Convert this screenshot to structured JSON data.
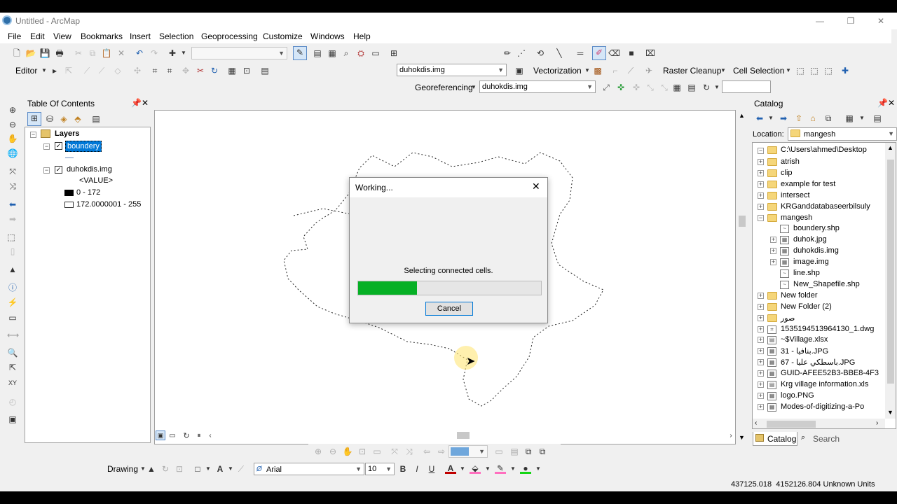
{
  "window": {
    "title": "Untitled - ArcMap",
    "minimize": "—",
    "restore": "❐",
    "close": "✕"
  },
  "menu": [
    "File",
    "Edit",
    "View",
    "Bookmarks",
    "Insert",
    "Selection",
    "Geoprocessing",
    "Customize",
    "Windows",
    "Help"
  ],
  "toolbar": {
    "editor_label": "Editor",
    "layer_combo": "duhokdis.img",
    "vectorization_label": "Vectorization",
    "raster_cleanup_label": "Raster Cleanup",
    "cell_selection_label": "Cell Selection",
    "georeferencing_label": "Georeferencing",
    "georef_layer_combo": "duhokdis.img"
  },
  "toc": {
    "title": "Table Of Contents",
    "layers_label": "Layers",
    "layer1_name": "boundery",
    "layer2_name": "duhokdis.img",
    "value_label": "<VALUE>",
    "legend1": "0 - 172",
    "legend2": "172.0000001 - 255"
  },
  "catalog": {
    "title": "Catalog",
    "location_label": "Location:",
    "location_value": "mangesh",
    "root": "C:\\Users\\ahmed\\Desktop",
    "items": [
      {
        "label": "atrish",
        "type": "folder",
        "level": 1
      },
      {
        "label": "clip",
        "type": "folder",
        "level": 1
      },
      {
        "label": "example for test",
        "type": "folder",
        "level": 1
      },
      {
        "label": "intersect",
        "type": "folder",
        "level": 1
      },
      {
        "label": "KRGanddatabaseerbilsuly",
        "type": "folder",
        "level": 1
      },
      {
        "label": "mangesh",
        "type": "folder-open",
        "level": 1
      },
      {
        "label": "boundery.shp",
        "type": "shp",
        "level": 2
      },
      {
        "label": "duhok.jpg",
        "type": "raster",
        "level": 2
      },
      {
        "label": "duhokdis.img",
        "type": "raster",
        "level": 2
      },
      {
        "label": "image.img",
        "type": "raster",
        "level": 2
      },
      {
        "label": "line.shp",
        "type": "shp",
        "level": 2
      },
      {
        "label": "New_Shapefile.shp",
        "type": "shp",
        "level": 2
      },
      {
        "label": "New folder",
        "type": "folder",
        "level": 1
      },
      {
        "label": "New Folder (2)",
        "type": "folder",
        "level": 1
      },
      {
        "label": "صور",
        "type": "folder",
        "level": 1
      },
      {
        "label": "1535194513964130_1.dwg",
        "type": "cad",
        "level": 1
      },
      {
        "label": "~$Village.xlsx",
        "type": "table",
        "level": 1
      },
      {
        "label": "31 - بنافيا.JPG",
        "type": "raster",
        "level": 1
      },
      {
        "label": "67 - باسطكي عليا.JPG",
        "type": "raster",
        "level": 1
      },
      {
        "label": "GUID-AFEE52B3-BBE8-4F3",
        "type": "raster",
        "level": 1
      },
      {
        "label": "Krg village information.xls",
        "type": "table",
        "level": 1
      },
      {
        "label": "logo.PNG",
        "type": "raster",
        "level": 1
      },
      {
        "label": "Modes-of-digitizing-a-Po",
        "type": "raster",
        "level": 1
      }
    ],
    "tab_catalog": "Catalog",
    "tab_search": "Search"
  },
  "dialog": {
    "title": "Working...",
    "message": "Selecting connected cells.",
    "progress": 0.32,
    "cancel_label": "Cancel"
  },
  "drawing_toolbar": {
    "drawing_label": "Drawing",
    "font_name": "Arial",
    "font_size": "10",
    "bold": "B",
    "italic": "I",
    "underline": "U"
  },
  "status": {
    "coordinates": "437125.018  4152126.804 Unknown Units"
  },
  "colors": {
    "progress_fill": "#06b025",
    "selection_highlight": "#0078d7"
  }
}
